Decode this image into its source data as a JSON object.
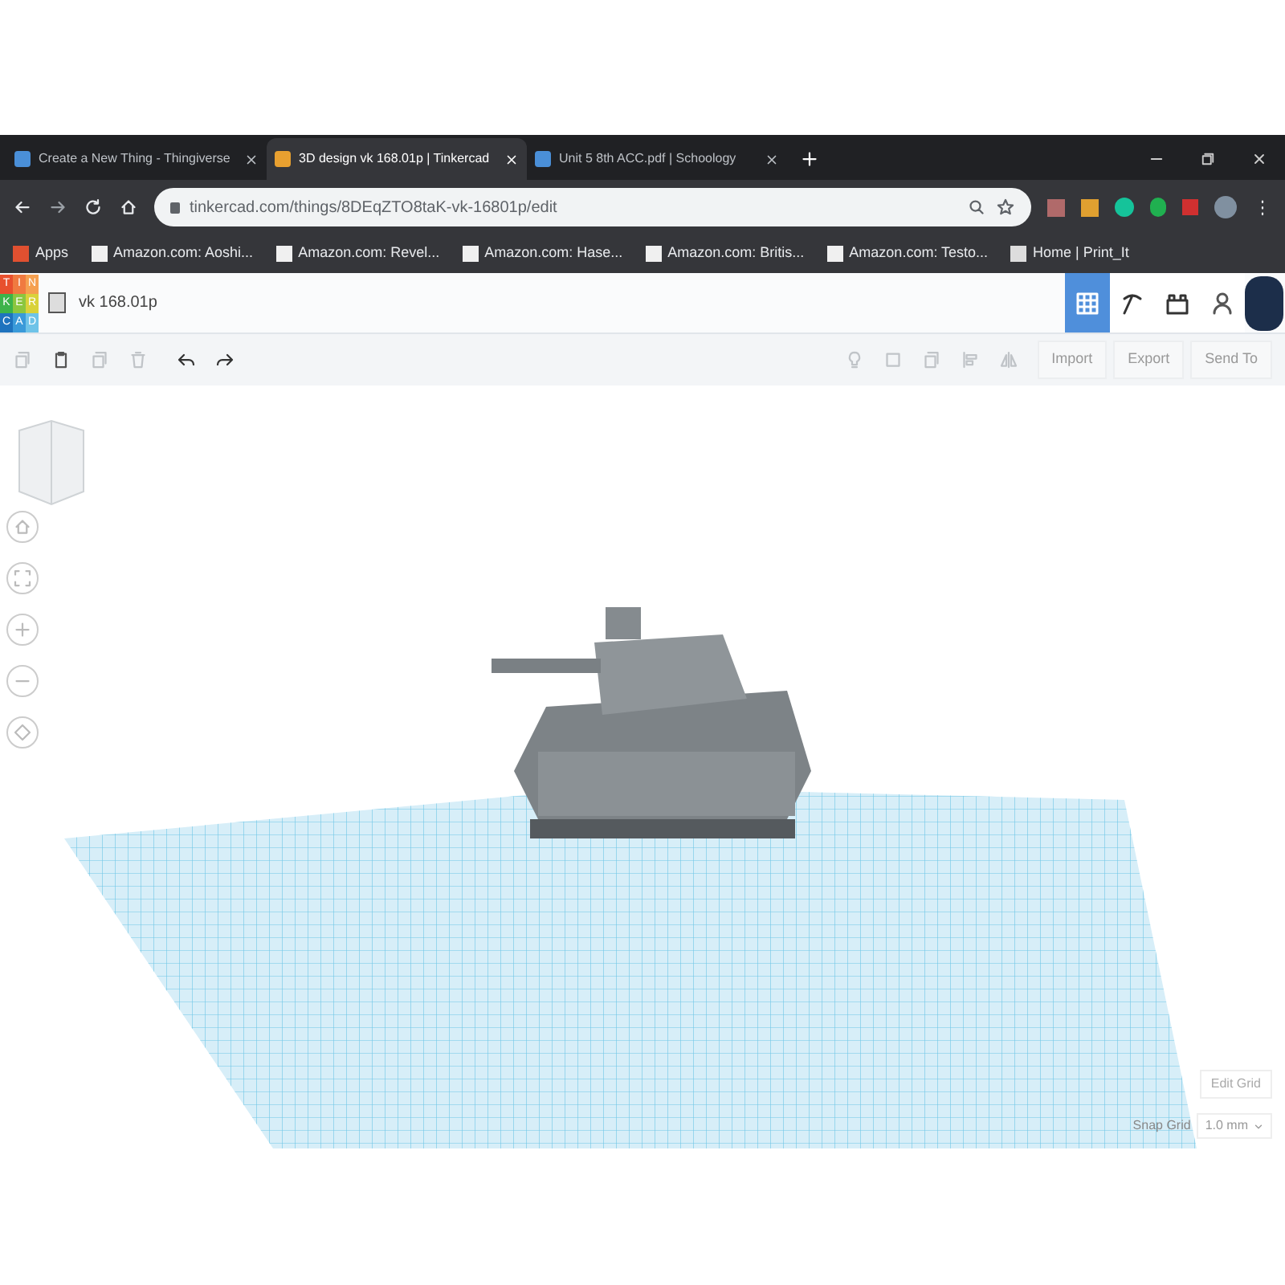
{
  "browser_tabs": [
    {
      "title": "Create a New Thing - Thingiverse",
      "selected": false
    },
    {
      "title": "3D design vk 168.01p | Tinkercad",
      "selected": true
    },
    {
      "title": "Unit 5 8th ACC.pdf | Schoology",
      "selected": false
    }
  ],
  "address_bar": {
    "url": "tinkercad.com/things/8DEqZTO8taK-vk-16801p/edit"
  },
  "bookmarks": [
    {
      "label": "Apps",
      "kind": "apps"
    },
    {
      "label": "Amazon.com: Aoshi...",
      "kind": "amazon"
    },
    {
      "label": "Amazon.com: Revel...",
      "kind": "amazon"
    },
    {
      "label": "Amazon.com: Hase...",
      "kind": "amazon"
    },
    {
      "label": "Amazon.com: Britis...",
      "kind": "amazon"
    },
    {
      "label": "Amazon.com: Testo...",
      "kind": "amazon"
    },
    {
      "label": "Home | Print_It",
      "kind": "site"
    }
  ],
  "header": {
    "logo_letters": [
      "T",
      "I",
      "N",
      "K",
      "E",
      "R",
      "C",
      "A",
      "D"
    ],
    "design_title": "vk 168.01p",
    "views": [
      {
        "kind": "grid",
        "selected": true
      },
      {
        "kind": "pickaxe",
        "selected": false
      },
      {
        "kind": "bricks",
        "selected": false
      }
    ]
  },
  "toolbar": {
    "actions": [
      "Import",
      "Export",
      "Send To"
    ]
  },
  "canvas": {
    "edit_grid": "Edit Grid",
    "snap_grid": {
      "label": "Snap Grid",
      "value": "1.0 mm"
    }
  }
}
